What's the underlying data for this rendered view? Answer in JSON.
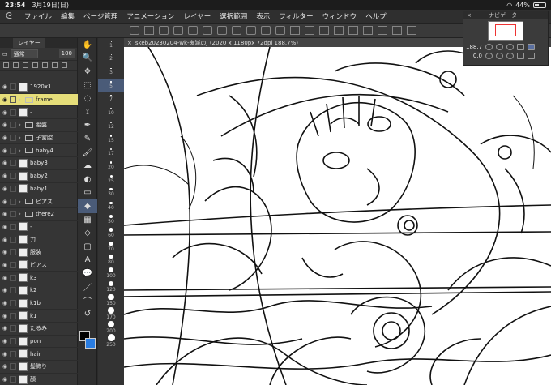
{
  "status": {
    "time": "23:54",
    "date": "3月19日(日)",
    "battery": "44%",
    "battery_level": 0.44
  },
  "menu": [
    "ファイル",
    "編集",
    "ページ管理",
    "アニメーション",
    "レイヤー",
    "選択範囲",
    "表示",
    "フィルター",
    "ウィンドウ",
    "ヘルプ"
  ],
  "layer_panel": {
    "tab": "レイヤー",
    "blend_mode": "通常",
    "opacity": "100",
    "layers": [
      {
        "name": "1920x1",
        "kind": "paper"
      },
      {
        "name": "frame",
        "kind": "folder",
        "selected": true
      },
      {
        "name": "-",
        "kind": "layer"
      },
      {
        "name": "胎盤",
        "kind": "folder"
      },
      {
        "name": "子宮腔",
        "kind": "folder"
      },
      {
        "name": "baby4",
        "kind": "folder"
      },
      {
        "name": "baby3",
        "kind": "layer"
      },
      {
        "name": "baby2",
        "kind": "layer"
      },
      {
        "name": "baby1",
        "kind": "layer"
      },
      {
        "name": "ピアス",
        "kind": "folder"
      },
      {
        "name": "there2",
        "kind": "folder"
      },
      {
        "name": "-",
        "kind": "layer"
      },
      {
        "name": "刀",
        "kind": "layer"
      },
      {
        "name": "服装",
        "kind": "layer"
      },
      {
        "name": "ピアス",
        "kind": "layer"
      },
      {
        "name": "k3",
        "kind": "layer"
      },
      {
        "name": "k2",
        "kind": "layer"
      },
      {
        "name": "k1b",
        "kind": "layer"
      },
      {
        "name": "k1",
        "kind": "layer"
      },
      {
        "name": "たるみ",
        "kind": "layer"
      },
      {
        "name": "pon",
        "kind": "layer"
      },
      {
        "name": "hair",
        "kind": "layer"
      },
      {
        "name": "髪飾り",
        "kind": "layer"
      },
      {
        "name": "顔",
        "kind": "layer"
      }
    ]
  },
  "tools": [
    "hand-icon",
    "zoom-icon",
    "move-icon",
    "select-icon",
    "lasso-icon",
    "eyedropper-icon",
    "pen-icon",
    "pencil-icon",
    "brush-icon",
    "airbrush-icon",
    "blend-icon",
    "eraser-icon",
    "fill-icon",
    "gradient-icon",
    "figure-icon",
    "frame-icon",
    "text-icon",
    "balloon-icon",
    "line-icon",
    "ruler-icon",
    "correct-icon"
  ],
  "brush_sizes": [
    "1",
    "2",
    "3",
    "5",
    "7",
    "10",
    "12",
    "15",
    "17",
    "20",
    "25",
    "30",
    "40",
    "50",
    "60",
    "70",
    "80",
    "100",
    "120",
    "150",
    "170",
    "200",
    "250"
  ],
  "canvas": {
    "title": "skeb20230204-wk-鬼滅のJ (2020 x 1180px 72dpi 188.7%)"
  },
  "navigator": {
    "title": "ナビゲーター",
    "zoom": "188.7",
    "rotation": "0.0"
  },
  "colors": {
    "foreground": "#000000",
    "background": "#2a7de1",
    "selected_layer": "#e6de7a"
  }
}
